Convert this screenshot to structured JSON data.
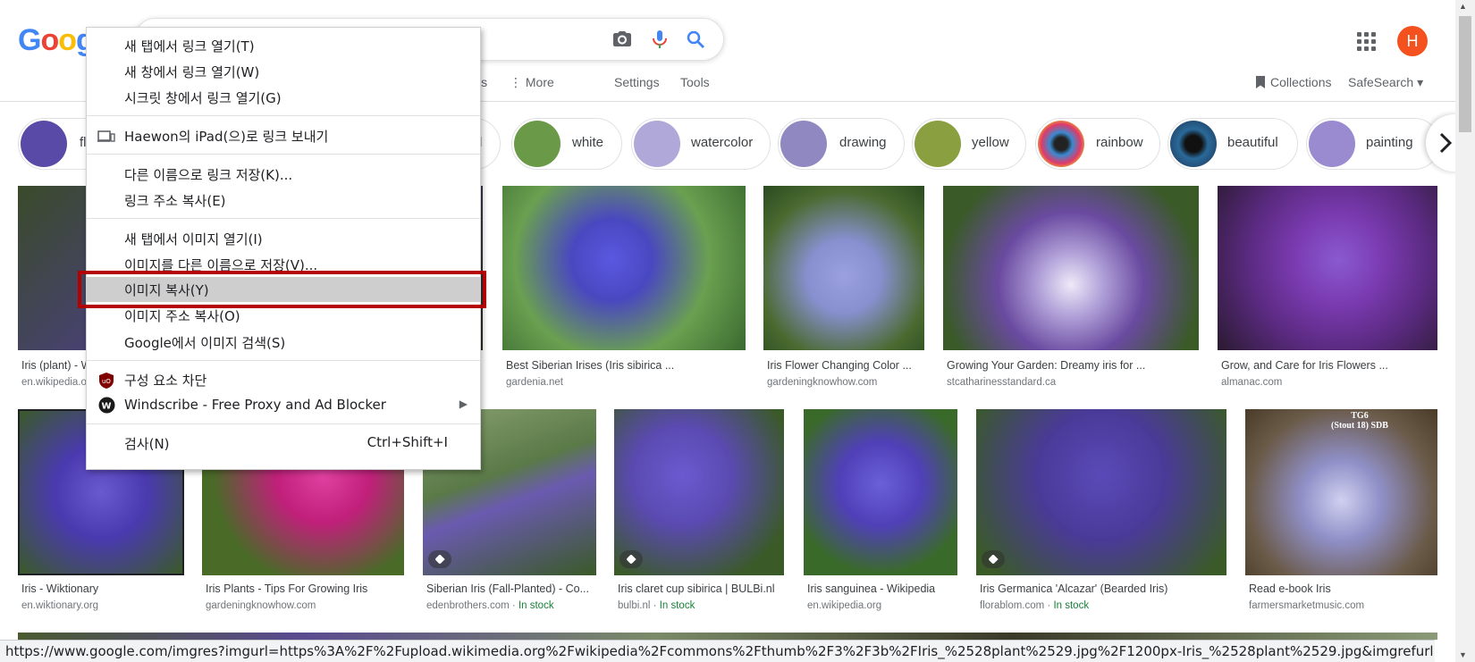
{
  "colors": {
    "accent": "#1a73e8",
    "highlight_box": "#b30000",
    "in_stock": "#188038",
    "avatar": "#f4511e"
  },
  "header": {
    "logo_text": "Goog",
    "icons": [
      "camera-icon",
      "mic-icon",
      "search-icon",
      "apps-icon"
    ],
    "avatar_letter": "H",
    "nav": {
      "partial": "ws",
      "more": "More",
      "settings": "Settings",
      "tools": "Tools",
      "collections": "Collections",
      "safesearch": "SafeSearch"
    }
  },
  "chips": [
    {
      "label": "fl",
      "color": "#5a4aa8"
    },
    {
      "label": "d",
      "color": "#8a7ac8"
    },
    {
      "label": "white",
      "color": "#6a9a48"
    },
    {
      "label": "watercolor",
      "color": "#b0a8d8"
    },
    {
      "label": "drawing",
      "color": "#9088c0"
    },
    {
      "label": "yellow",
      "color": "#8aa040"
    },
    {
      "label": "rainbow",
      "color": "#e03a6a"
    },
    {
      "label": "beautiful",
      "color": "#2a5a8a"
    },
    {
      "label": "painting",
      "color": "#9a8ad0"
    }
  ],
  "results_row1": [
    {
      "title": "Iris (plant) - W",
      "source": "en.wikipedia.o",
      "color": "#4a4080"
    },
    {
      "title": "Best Siberian Irises (Iris sibirica ...",
      "source": "gardenia.net",
      "color": "#4a48c0"
    },
    {
      "title": "Iris Flower Changing Color ...",
      "source": "gardeningknowhow.com",
      "color": "#8890d0"
    },
    {
      "title": "Growing Your Garden: Dreamy iris for ...",
      "source": "stcatharinesstandard.ca",
      "color": "#6a4aa0"
    },
    {
      "title": "Grow, and Care for Iris Flowers ...",
      "source": "almanac.com",
      "color": "#7a3ab0"
    }
  ],
  "results_row2": [
    {
      "title": "Iris - Wiktionary",
      "source": "en.wiktionary.org",
      "stock": "",
      "color": "#4a3ab0"
    },
    {
      "title": "Iris Plants - Tips For Growing Iris",
      "source": "gardeningknowhow.com",
      "stock": "",
      "color": "#c0207a"
    },
    {
      "title": "Siberian Iris (Fall-Planted) - Co...",
      "source": "edenbrothers.com",
      "stock": "In stock",
      "color": "#5a7a48"
    },
    {
      "title": "Iris claret cup sibirica | BULBi.nl",
      "source": "bulbi.nl",
      "stock": "In stock",
      "color": "#5a4ab0"
    },
    {
      "title": "Iris sanguinea - Wikipedia",
      "source": "en.wikipedia.org",
      "stock": "",
      "color": "#5040b8"
    },
    {
      "title": "Iris Germanica 'Alcazar' (Bearded Iris)",
      "source": "florablom.com",
      "stock": "In stock",
      "color": "#4a3a98"
    },
    {
      "title": "Read e-book Iris",
      "source": "farmersmarketmusic.com",
      "stock": "",
      "color": "#9090c8",
      "overlay": "TG6\n(Stout 18) SDB"
    }
  ],
  "context_menu": {
    "items": [
      {
        "label": "새 탭에서 링크 열기(T)"
      },
      {
        "label": "새 창에서 링크 열기(W)"
      },
      {
        "label": "시크릿 창에서 링크 열기(G)"
      },
      {
        "label": "Haewon의 iPad(으)로 링크 보내기",
        "icon": "device-icon"
      },
      {
        "label": "다른 이름으로 링크 저장(K)..."
      },
      {
        "label": "링크 주소 복사(E)"
      },
      {
        "label": "새 탭에서 이미지 열기(I)"
      },
      {
        "label": "이미지를 다른 이름으로 저장(V)..."
      },
      {
        "label": "이미지 복사(Y)"
      },
      {
        "label": "이미지 주소 복사(O)"
      },
      {
        "label": "Google에서 이미지 검색(S)"
      },
      {
        "label": "구성 요소 차단",
        "icon": "ublock-icon"
      },
      {
        "label": "Windscribe - Free Proxy and Ad Blocker",
        "icon": "windscribe-icon"
      },
      {
        "label": "검사(N)",
        "shortcut": "Ctrl+Shift+I"
      }
    ]
  },
  "status_url": "https://www.google.com/imgres?imgurl=https%3A%2F%2Fupload.wikimedia.org%2Fwikipedia%2Fcommons%2Fthumb%2F3%2F3b%2FIris_%2528plant%2529.jpg%2F1200px-Iris_%2528plant%2529.jpg&imgrefurl=https%3A%2F%2Fe..."
}
